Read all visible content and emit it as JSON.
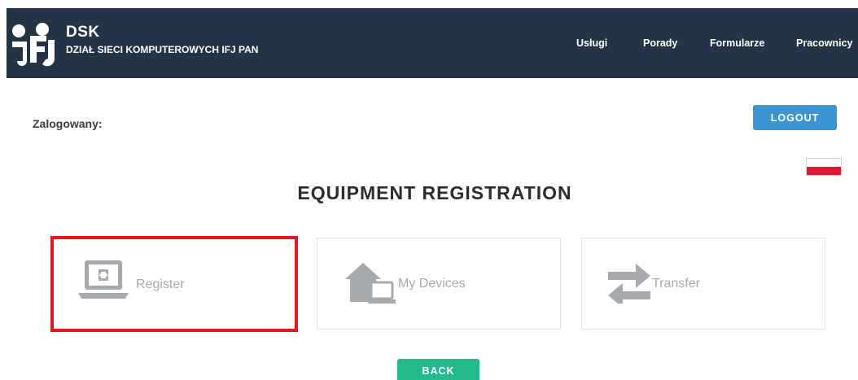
{
  "header": {
    "brand_title": "DSK",
    "brand_subtitle": "DZIAŁ SIECI KOMPUTEROWYCH IFJ PAN",
    "logo_icon": "ifj-logo-icon",
    "nav": [
      "Usługi",
      "Porady",
      "Formularze",
      "Pracownicy"
    ]
  },
  "user": {
    "logged_in_label": "Zalogowany:",
    "logout_label": "LOGOUT",
    "language_flag": "poland-flag-icon"
  },
  "main": {
    "title": "EQUIPMENT REGISTRATION",
    "tiles": [
      {
        "label": "Register",
        "icon": "laptop-plus-icon",
        "highlighted": true
      },
      {
        "label": "My Devices",
        "icon": "home-devices-icon",
        "highlighted": false
      },
      {
        "label": "Transfer",
        "icon": "transfer-arrows-icon",
        "highlighted": false
      }
    ],
    "back_label": "BACK"
  },
  "colors": {
    "header_bg": "#243447",
    "logout_bg": "#3b95d3",
    "back_bg": "#23b98a",
    "highlight_border": "#e5161d",
    "tile_icon": "#a6a9ad"
  }
}
